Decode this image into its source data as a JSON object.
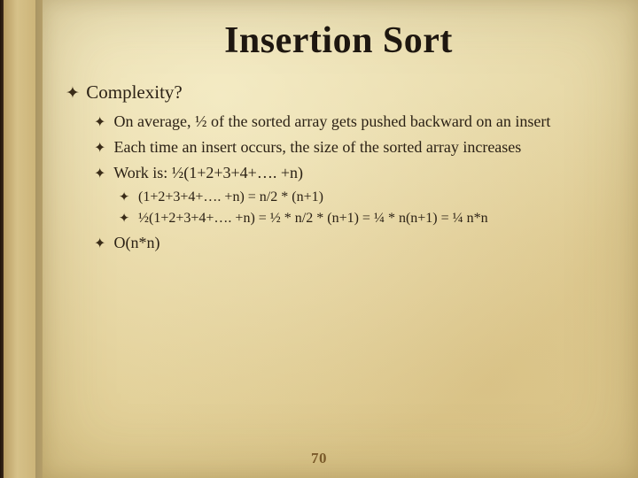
{
  "title": "Insertion Sort",
  "bullets": {
    "l1_complexity": "Complexity?",
    "l2_avg": "On average, ½ of the sorted array gets pushed backward on an insert",
    "l2_each": "Each time an insert occurs, the size of the sorted array increases",
    "l2_work": "Work is:   ½(1+2+3+4+…. +n)",
    "l3_sum": "(1+2+3+4+…. +n) = n/2 * (n+1)",
    "l3_half": "½(1+2+3+4+…. +n) = ½ * n/2 * (n+1)  =  ¼ * n(n+1) = ¼ n*n",
    "l2_bigo": "O(n*n)"
  },
  "bullet_glyph": "✦",
  "page_number": "70"
}
